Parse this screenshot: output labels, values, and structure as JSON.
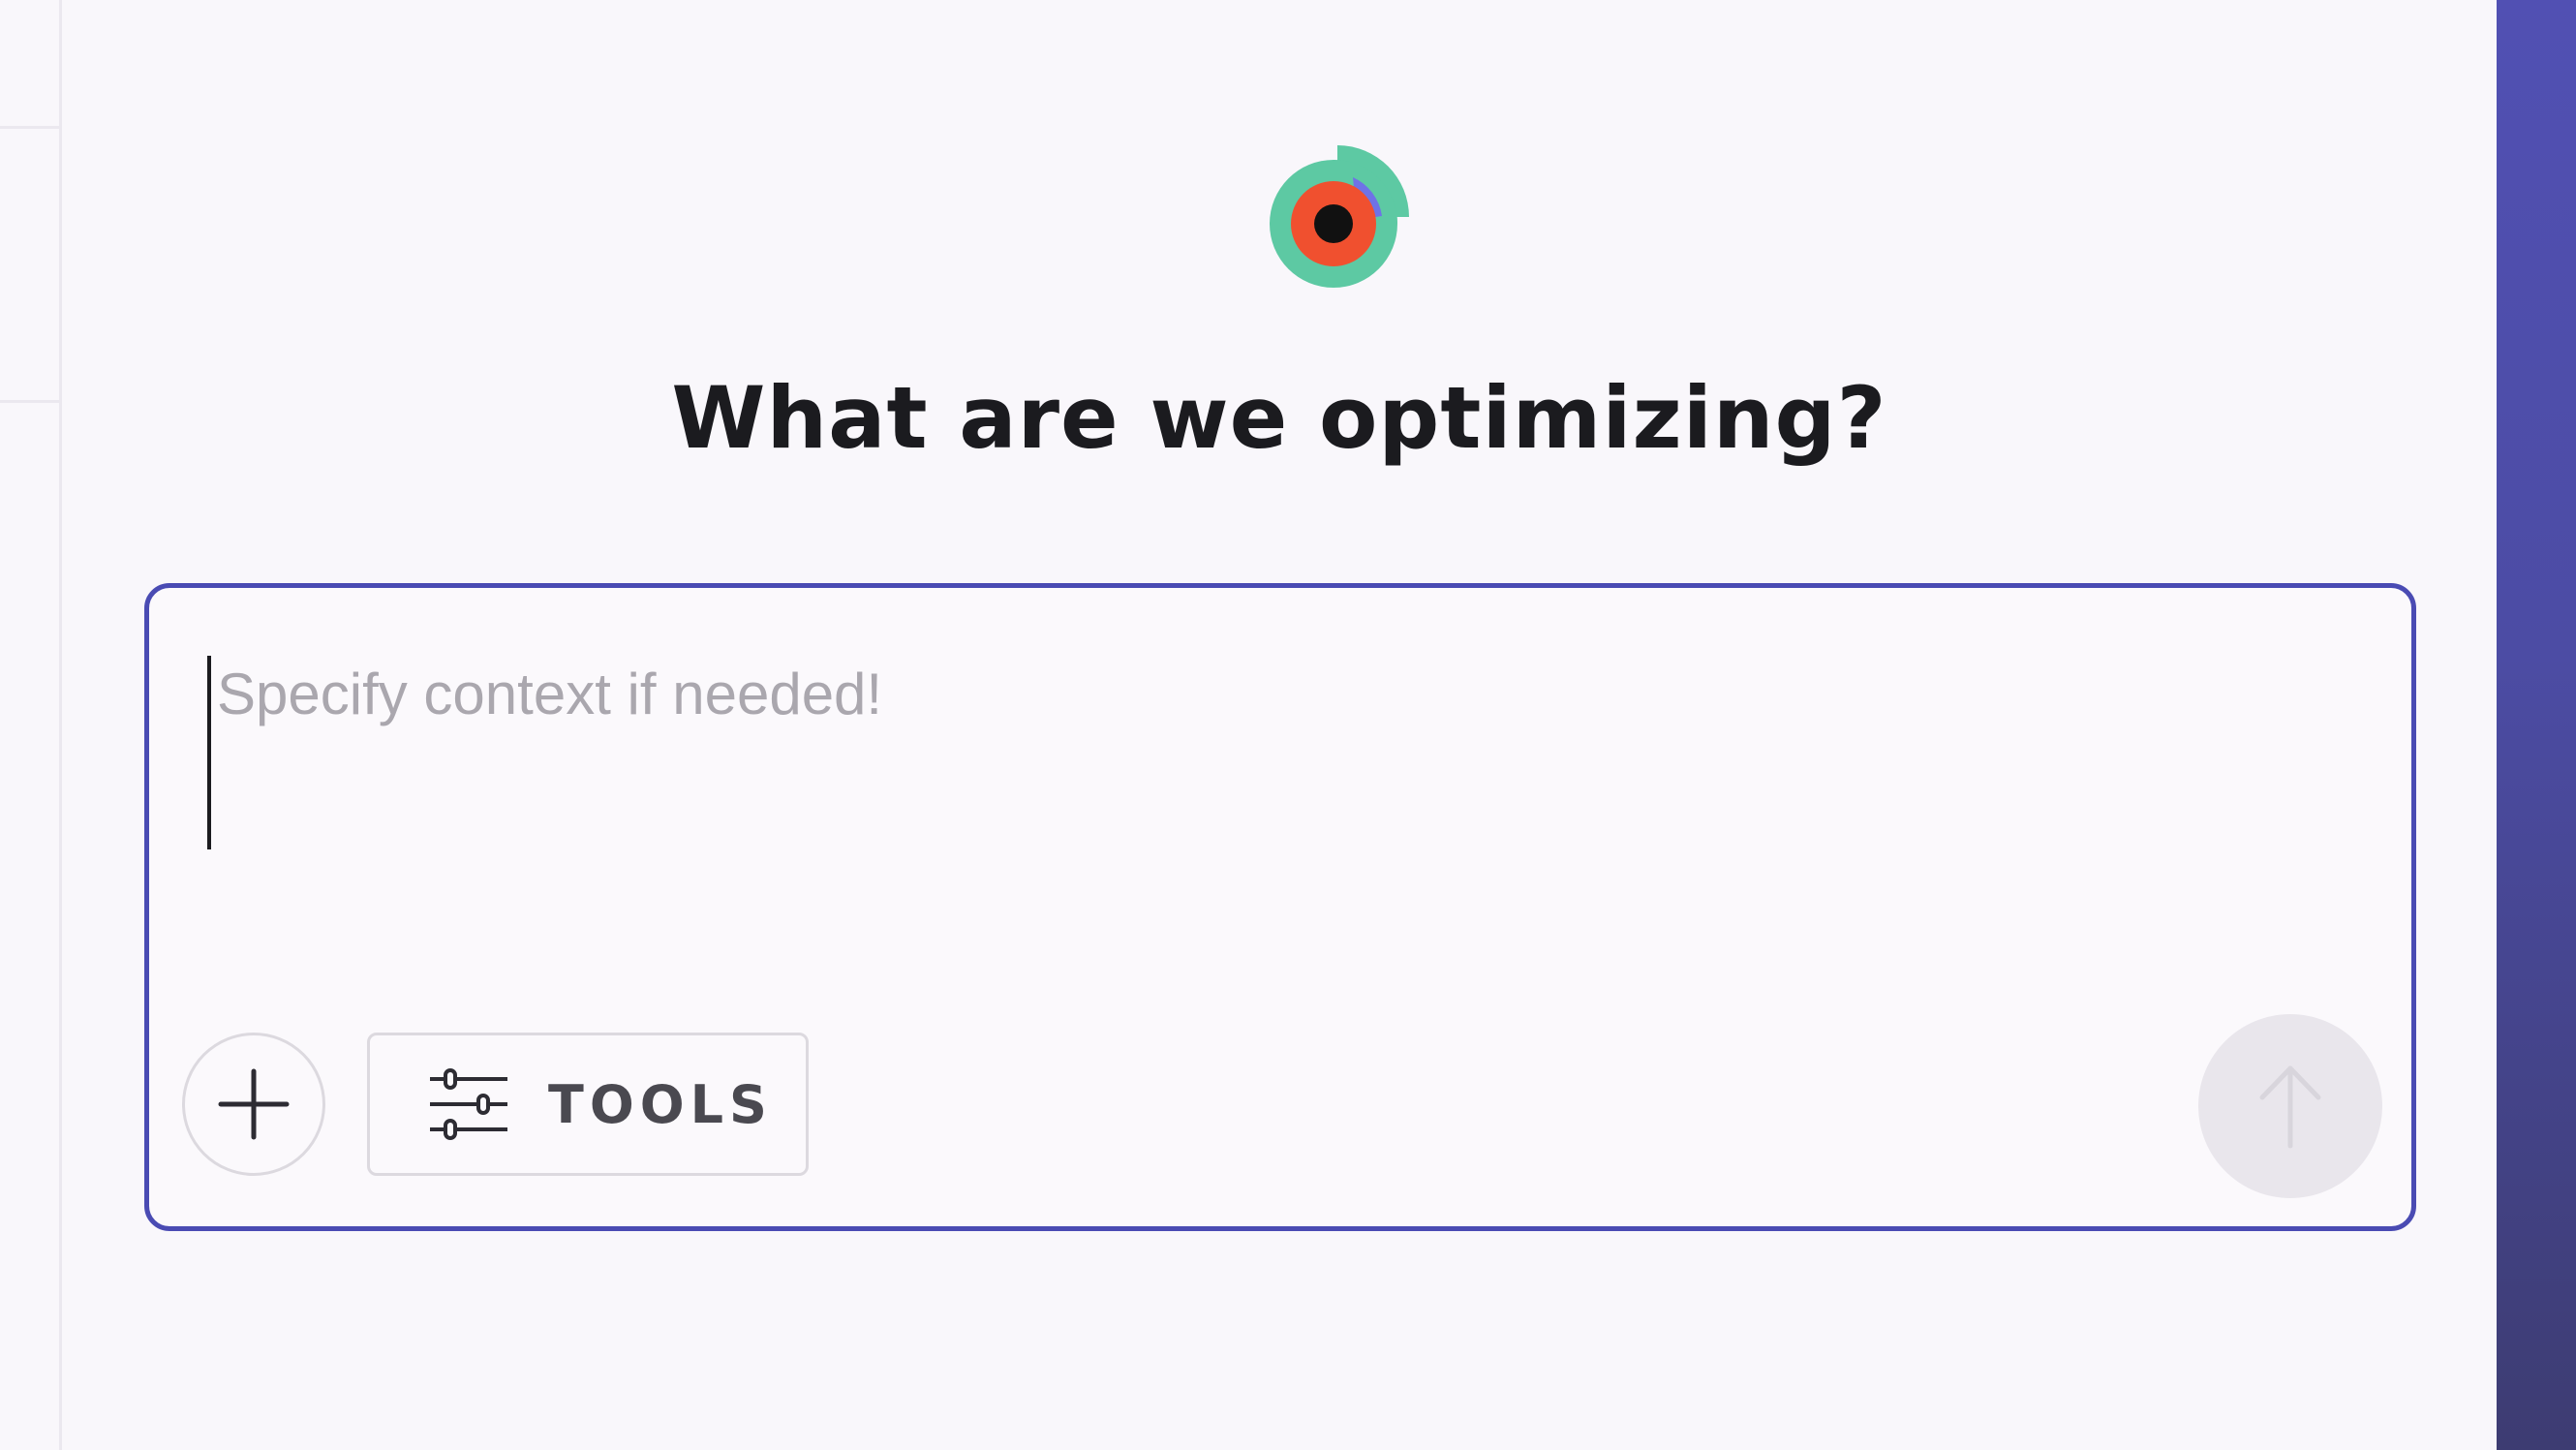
{
  "app": {
    "logo_icon": "target-eye-logo-icon",
    "accent_color": "#4a4bb3"
  },
  "hero": {
    "title": "What are we optimizing?"
  },
  "composer": {
    "input_value": "",
    "placeholder": "Specify context if needed!",
    "add_icon": "plus-icon",
    "tools_label": "TOOLS",
    "tools_icon": "sliders-icon",
    "send_icon": "arrow-up-icon",
    "send_enabled": false
  }
}
